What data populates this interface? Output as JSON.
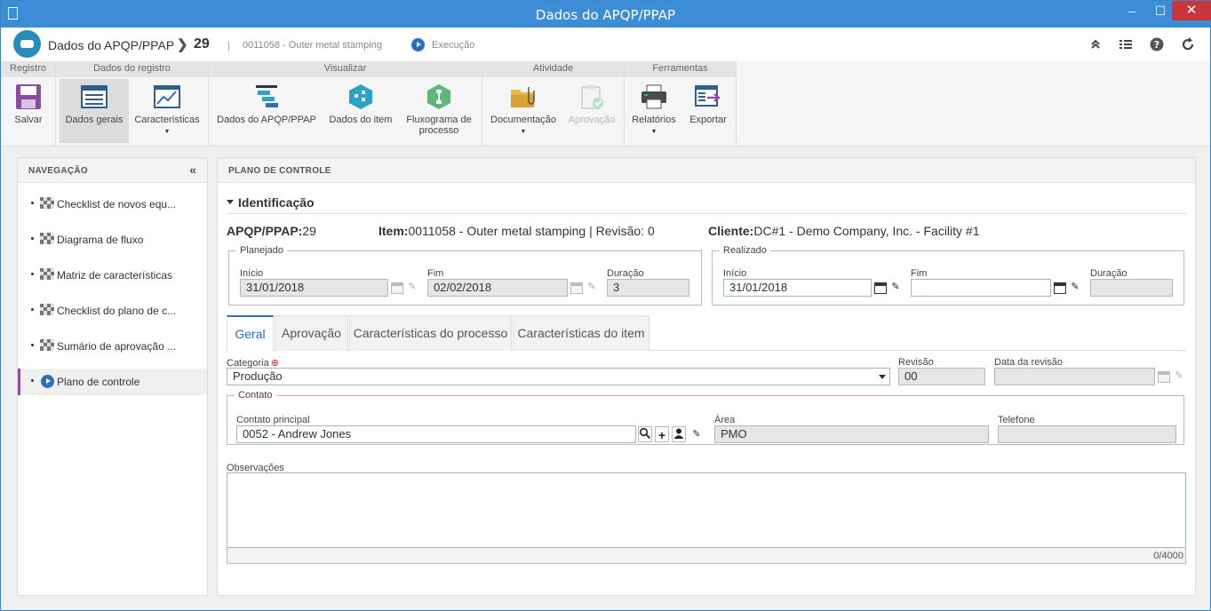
{
  "window": {
    "title": "Dados do APQP/PPAP",
    "min": "–",
    "max": "☐",
    "close": "✕"
  },
  "header": {
    "title": "Dados do APQP/PPAP",
    "chevron": "❯",
    "number": "29",
    "separator": "|",
    "subtitle": "0011058 - Outer metal stamping",
    "status": "Execução",
    "tools": [
      "collapse-up-icon",
      "list-icon",
      "help-icon",
      "refresh-icon"
    ]
  },
  "ribbon": {
    "groups": {
      "registro": "Registro",
      "dados_registro": "Dados do registro",
      "visualizar": "Visualizar",
      "atividade": "Atividade",
      "ferramentas": "Ferramentas"
    },
    "buttons": {
      "salvar": "Salvar",
      "dados_gerais": "Dados gerais",
      "caracteristicas": "Características",
      "dados_apqp": "Dados do APQP/PPAP",
      "dados_item": "Dados do item",
      "fluxograma_1": "Fluxograma de",
      "fluxograma_2": "processo",
      "documentacao": "Documentação",
      "aprovacao": "Aprovação",
      "relatorios": "Relatórios",
      "exportar": "Exportar"
    },
    "caret": "▼"
  },
  "nav": {
    "title": "NAVEGAÇÃO",
    "collapse": "«",
    "items": [
      {
        "label": "Checklist de novos equ..."
      },
      {
        "label": "Diagrama de fluxo"
      },
      {
        "label": "Matriz de características"
      },
      {
        "label": "Checklist do plano de c..."
      },
      {
        "label": "Sumário de aprovação ..."
      },
      {
        "label": "Plano de controle"
      }
    ]
  },
  "main": {
    "title": "PLANO DE CONTROLE",
    "section": "Identificação",
    "apqp_label": "APQP/PPAP:",
    "apqp_value": "29",
    "item_label": "Item:",
    "item_value": "0011058 - Outer metal stamping | Revisão: 0",
    "cliente_label": "Cliente:",
    "cliente_value": "DC#1 - Demo Company, Inc. - Facility #1",
    "planejado": {
      "legend": "Planejado",
      "inicio_label": "Início",
      "inicio": "31/01/2018",
      "fim_label": "Fim",
      "fim": "02/02/2018",
      "duracao_label": "Duração",
      "duracao": "3"
    },
    "realizado": {
      "legend": "Realizado",
      "inicio_label": "Início",
      "inicio": "31/01/2018",
      "fim_label": "Fim",
      "fim": "",
      "duracao_label": "Duração",
      "duracao": ""
    },
    "tabs": [
      "Geral",
      "Aprovação",
      "Características do processo",
      "Características do item"
    ],
    "categoria_label": "Categoria",
    "categoria_required": "⊕",
    "categoria": "Produção",
    "revisao_label": "Revisão",
    "revisao": "00",
    "data_revisao_label": "Data da revisão",
    "data_revisao": "",
    "contato": {
      "legend": "Contato",
      "principal_label": "Contato principal",
      "principal": "0052 - Andrew Jones",
      "area_label": "Área",
      "area": "PMO",
      "telefone_label": "Telefone",
      "telefone": ""
    },
    "observacoes_label": "Observações",
    "observacoes": "",
    "counter": "0/4000"
  },
  "colors": {
    "accent": "#2a6fc2",
    "titlebar": "#3c8dd6",
    "nav_active": "#8d4fa3",
    "close": "#c9373b"
  }
}
